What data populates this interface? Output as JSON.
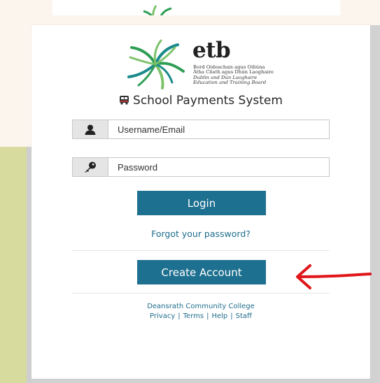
{
  "brand": {
    "logo_word": "etb",
    "logo_lines": [
      "Bord Oideachais agus Oiliúna",
      "Átha Cliath agus Dhún Laoghaire",
      "Dublin and Dún Laoghaire",
      "Education and Training Board"
    ],
    "color": "#1e7090"
  },
  "page": {
    "title": "School Payments System",
    "title_icon": "school-bus-icon"
  },
  "form": {
    "username": {
      "placeholder": "Username/Email",
      "value": "",
      "icon": "user-icon"
    },
    "password": {
      "placeholder": "Password",
      "value": "",
      "icon": "key-icon"
    },
    "login_label": "Login",
    "forgot_label": "Forgot your password?",
    "create_label": "Create Account"
  },
  "footer": {
    "school": "Deansrath Community College",
    "links": [
      "Privacy",
      "Terms",
      "Help",
      "Staff"
    ]
  },
  "annotation": {
    "arrow_color": "#e0161a"
  }
}
